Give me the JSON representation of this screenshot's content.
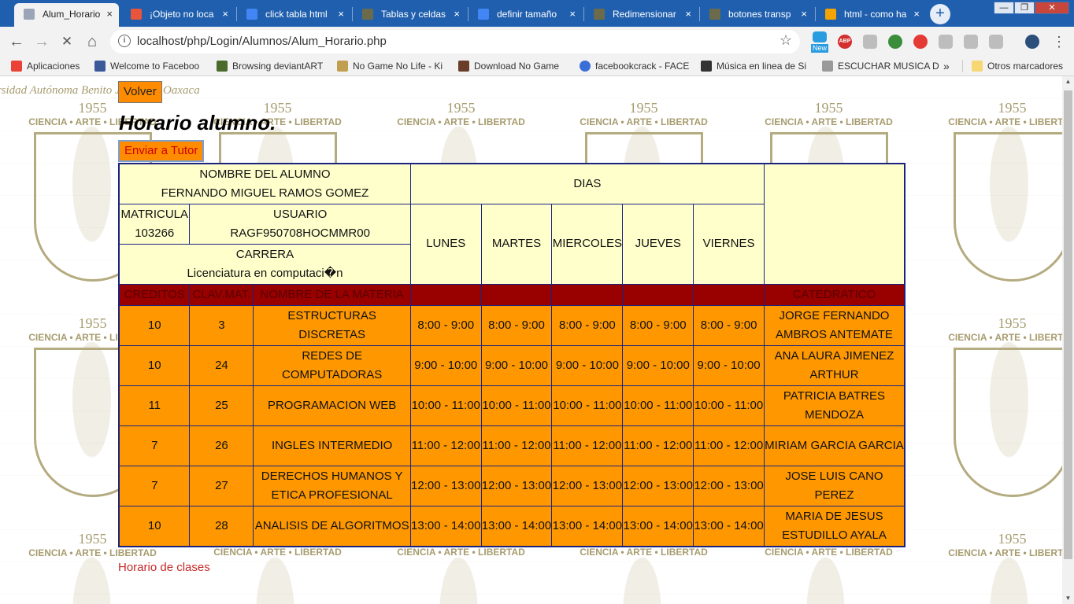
{
  "browser": {
    "tabs": [
      {
        "label": "Alum_Horario",
        "active": true,
        "icon_color": "#9aa6b8"
      },
      {
        "label": "¡Objeto no loca",
        "icon_color": "#e8553b"
      },
      {
        "label": "click tabla html",
        "icon_color": "#4285f4"
      },
      {
        "label": "Tablas y celdas",
        "icon_color": "#6b6b4b"
      },
      {
        "label": "definir tamaño",
        "icon_color": "#4285f4"
      },
      {
        "label": "Redimensionar",
        "icon_color": "#6b6b4b"
      },
      {
        "label": "botones transp",
        "icon_color": "#6b6b4b"
      },
      {
        "label": "html - como ha",
        "icon_color": "#f4a300"
      }
    ],
    "close_glyph": "×",
    "new_tab_glyph": "+",
    "window_controls": {
      "minimize": "—",
      "maximize": "❐",
      "close": "✕"
    },
    "nav": {
      "back": "←",
      "forward": "→",
      "stop": "✕",
      "home": "⌂"
    },
    "url": "localhost/php/Login/Alumnos/Alum_Horario.php",
    "info_glyph": "i",
    "star_glyph": "☆",
    "menu_glyph": "⋮",
    "extensions": [
      "#2a9de0",
      "#d32f2f",
      "#bdbdbd",
      "#3a8d3a",
      "#e53935",
      "#bdbdbd",
      "#bdbdbd",
      "#bdbdbd",
      "#2b4f7a"
    ],
    "ext_new_badge": "New",
    "ext_abp_label": "ABP",
    "bookmarks": [
      {
        "label": "Aplicaciones",
        "icon_color": "#ea4335"
      },
      {
        "label": "Welcome to Faceboo",
        "icon_color": "#3b5998"
      },
      {
        "label": "Browsing deviantART",
        "icon_color": "#4a6b2b"
      },
      {
        "label": "No Game No Life - Ki",
        "icon_color": "#c0a050"
      },
      {
        "label": "Download No Game",
        "icon_color": "#6a3d2a"
      },
      {
        "label": "facebookcrack - FACE",
        "icon_color": "#3b6fd8"
      },
      {
        "label": "Música en linea de Si",
        "icon_color": "#333333"
      },
      {
        "label": "ESCUCHAR MUSICA D",
        "icon_color": "#999999"
      }
    ],
    "bookmarks_more": "»",
    "other_bookmarks": "Otros marcadores"
  },
  "watermark": {
    "university_arc": "Universidad Autónoma Benito Juárez de Oaxaca",
    "year": "1955",
    "motto": "CIENCIA • ARTE • LIBERTAD"
  },
  "page": {
    "back_button": "Volver",
    "heading": "Horario alumno.",
    "send_button": "Enviar a Tutor",
    "footer_link": "Horario de clases"
  },
  "schedule": {
    "student_name_label": "NOMBRE DEL ALUMNO",
    "student_name": "FERNANDO MIGUEL RAMOS GOMEZ",
    "days_label": "DIAS",
    "matricula_label": "MATRICULA",
    "matricula": "103266",
    "usuario_label": "USUARIO",
    "usuario": "RAGF950708HOCMMR00",
    "carrera_label": "CARRERA",
    "carrera": "Licenciatura en computaci�n",
    "days": [
      "LUNES",
      "MARTES",
      "MIERCOLES",
      "JUEVES",
      "VIERNES"
    ],
    "columns": {
      "creditos": "CREDITOS",
      "clave": "CLAV.MAT.",
      "materia": "NOMBRE DE LA MATERIA",
      "catedratico": "CATEDRATICO"
    },
    "rows": [
      {
        "creditos": "10",
        "clave": "3",
        "materia": "ESTRUCTURAS DISCRETAS",
        "horario": "8:00 - 9:00",
        "catedratico": "JORGE FERNANDO AMBROS ANTEMATE"
      },
      {
        "creditos": "10",
        "clave": "24",
        "materia": "REDES DE COMPUTADORAS",
        "horario": "9:00 - 10:00",
        "catedratico": "ANA LAURA JIMENEZ ARTHUR"
      },
      {
        "creditos": "11",
        "clave": "25",
        "materia": "PROGRAMACION WEB",
        "horario": "10:00 - 11:00",
        "catedratico": "PATRICIA BATRES MENDOZA"
      },
      {
        "creditos": "7",
        "clave": "26",
        "materia": "INGLES INTERMEDIO",
        "horario": "11:00 - 12:00",
        "catedratico": "MIRIAM GARCIA GARCIA"
      },
      {
        "creditos": "7",
        "clave": "27",
        "materia": "DERECHOS HUMANOS Y ETICA PROFESIONAL",
        "horario": "12:00 - 13:00",
        "catedratico": "JOSE LUIS CANO PEREZ"
      },
      {
        "creditos": "10",
        "clave": "28",
        "materia": "ANALISIS DE ALGORITMOS",
        "horario": "13:00 - 14:00",
        "catedratico": "MARIA DE JESUS ESTUDILLO AYALA"
      }
    ]
  },
  "colors": {
    "tabstrip": "#1f5fae",
    "button_orange": "#ff8c00",
    "table_yellow": "#ffffcc",
    "table_header_red": "#990000",
    "row_orange": "#ff9800",
    "link_red": "#c62828"
  }
}
